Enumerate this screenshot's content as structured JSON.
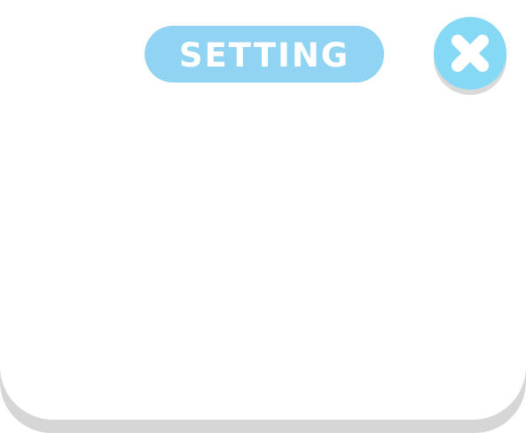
{
  "dialog": {
    "title": "SETTING",
    "close_icon": "close-icon"
  },
  "colors": {
    "panel": "#ffffff",
    "panel_shadow": "#d6d6d6",
    "title_pill": "#91d3f2",
    "close_button": "#86d9f5",
    "close_shadow": "#d9d9d9",
    "icon": "#ffffff"
  }
}
